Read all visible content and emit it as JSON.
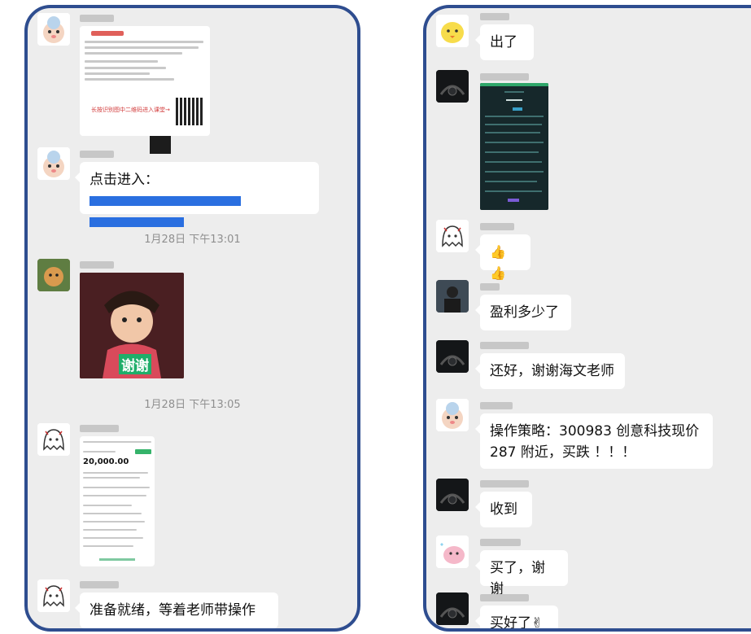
{
  "left_panel": {
    "timestamps": [
      "1月28日 下午13:01",
      "1月28日 下午13:05"
    ],
    "messages": {
      "link_prefix": "点击进入：",
      "promo_footer": "长按识别图中二维码进入课堂→",
      "sticker_caption": "谢谢",
      "receipt_amount": "20,000.00",
      "ready": "准备就绪，等着老师带操作"
    }
  },
  "right_panel": {
    "messages": {
      "out": "出了",
      "thumbs": "👍👍",
      "profit_q": "盈利多少了",
      "thanks": "还好，谢谢海文老师",
      "strategy": "操作策略：300983 创意科技现价287 附近，买跌 ！！！",
      "received": "收到",
      "bought_thanks": "买了，谢谢",
      "bought_ok": "买好了✌"
    }
  },
  "colors": {
    "frame": "#2e4d8f",
    "chat_bg": "#ededed",
    "link": "#2a6fe0",
    "green": "#35b36a"
  }
}
